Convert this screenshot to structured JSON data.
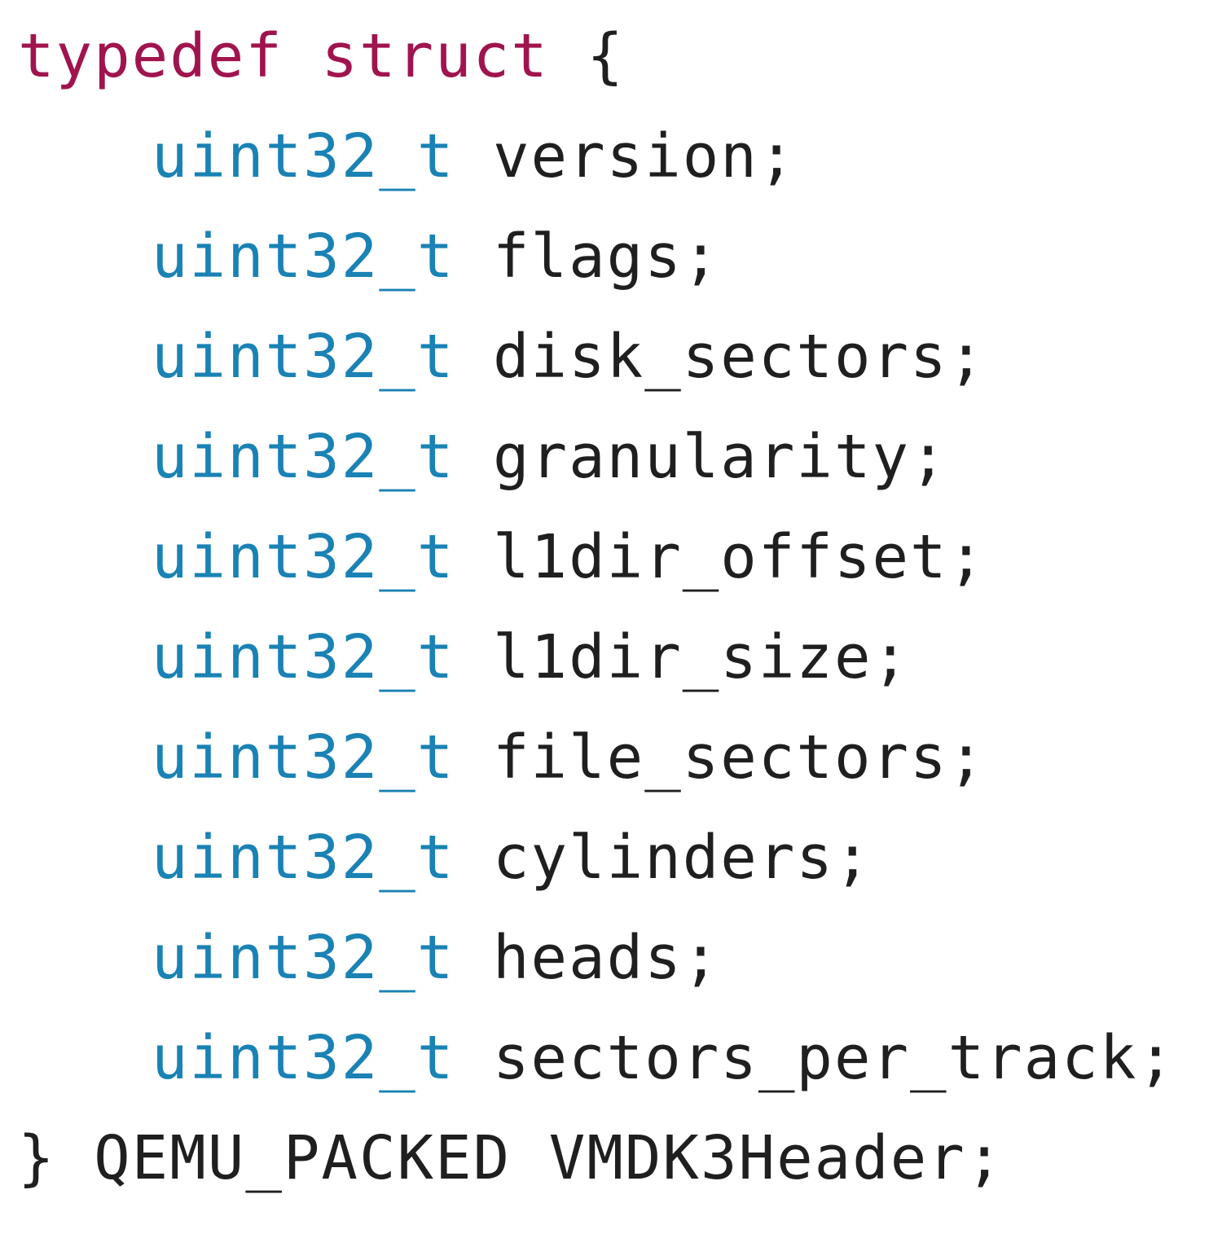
{
  "code": {
    "open_line": {
      "keyword_typedef": "typedef",
      "keyword_struct": "struct",
      "open_brace": "{"
    },
    "fields": [
      {
        "type": "uint32_t",
        "name": "version;"
      },
      {
        "type": "uint32_t",
        "name": "flags;"
      },
      {
        "type": "uint32_t",
        "name": "disk_sectors;"
      },
      {
        "type": "uint32_t",
        "name": "granularity;"
      },
      {
        "type": "uint32_t",
        "name": "l1dir_offset;"
      },
      {
        "type": "uint32_t",
        "name": "l1dir_size;"
      },
      {
        "type": "uint32_t",
        "name": "file_sectors;"
      },
      {
        "type": "uint32_t",
        "name": "cylinders;"
      },
      {
        "type": "uint32_t",
        "name": "heads;"
      },
      {
        "type": "uint32_t",
        "name": "sectors_per_track;"
      }
    ],
    "close_line": {
      "close_brace": "}",
      "attribute": "QEMU_PACKED",
      "struct_name": "VMDK3Header;"
    },
    "colors": {
      "keyword": "#a0144e",
      "type": "#1a82b4",
      "identifier": "#1f1f1f"
    }
  }
}
